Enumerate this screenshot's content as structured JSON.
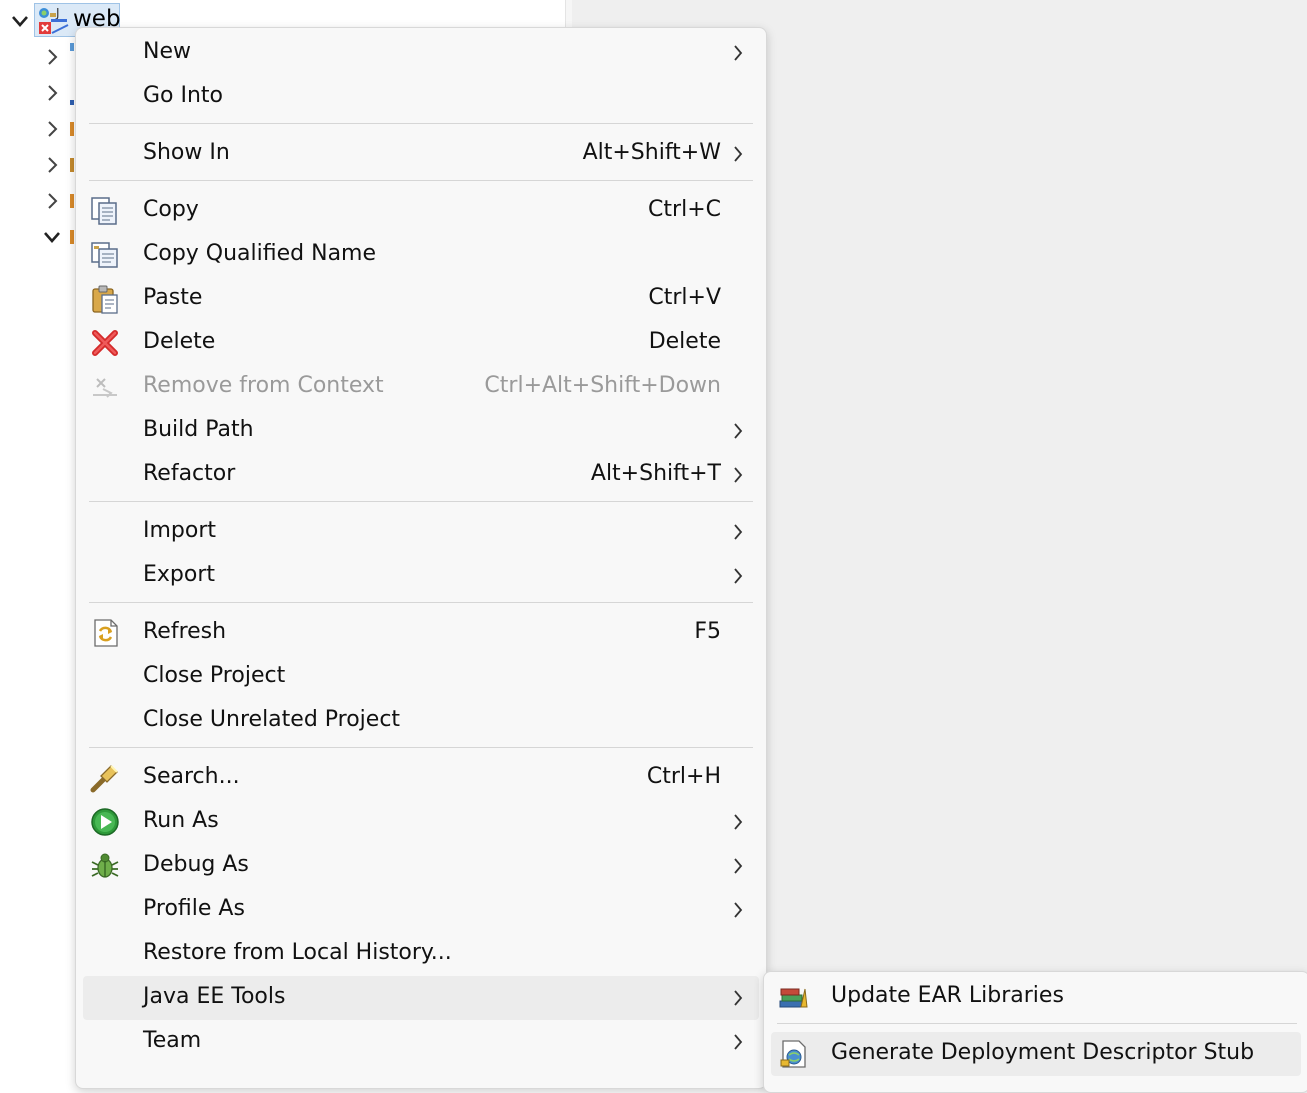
{
  "tree": {
    "project_label": "web"
  },
  "context_menu": {
    "items": [
      {
        "label": "New",
        "shortcut": "",
        "submenu": true,
        "icon": ""
      },
      {
        "label": "Go Into",
        "shortcut": "",
        "submenu": false,
        "icon": ""
      },
      {
        "label": "Show In",
        "shortcut": "Alt+Shift+W",
        "submenu": true,
        "icon": ""
      },
      {
        "label": "Copy",
        "shortcut": "Ctrl+C",
        "submenu": false,
        "icon": "copy-icon"
      },
      {
        "label": "Copy Qualified Name",
        "shortcut": "",
        "submenu": false,
        "icon": "copy-qualified-name-icon"
      },
      {
        "label": "Paste",
        "shortcut": "Ctrl+V",
        "submenu": false,
        "icon": "paste-icon"
      },
      {
        "label": "Delete",
        "shortcut": "Delete",
        "submenu": false,
        "icon": "delete-icon"
      },
      {
        "label": "Remove from Context",
        "shortcut": "Ctrl+Alt+Shift+Down",
        "submenu": false,
        "icon": "remove-from-context-icon",
        "disabled": true
      },
      {
        "label": "Build Path",
        "shortcut": "",
        "submenu": true,
        "icon": ""
      },
      {
        "label": "Refactor",
        "shortcut": "Alt+Shift+T",
        "submenu": true,
        "icon": ""
      },
      {
        "label": "Import",
        "shortcut": "",
        "submenu": true,
        "icon": ""
      },
      {
        "label": "Export",
        "shortcut": "",
        "submenu": true,
        "icon": ""
      },
      {
        "label": "Refresh",
        "shortcut": "F5",
        "submenu": false,
        "icon": "refresh-icon"
      },
      {
        "label": "Close Project",
        "shortcut": "",
        "submenu": false,
        "icon": ""
      },
      {
        "label": "Close Unrelated Project",
        "shortcut": "",
        "submenu": false,
        "icon": ""
      },
      {
        "label": "Search...",
        "shortcut": "Ctrl+H",
        "submenu": false,
        "icon": "search-flashlight-icon"
      },
      {
        "label": "Run As",
        "shortcut": "",
        "submenu": true,
        "icon": "run-icon"
      },
      {
        "label": "Debug As",
        "shortcut": "",
        "submenu": true,
        "icon": "debug-bug-icon"
      },
      {
        "label": "Profile As",
        "shortcut": "",
        "submenu": true,
        "icon": ""
      },
      {
        "label": "Restore from Local History...",
        "shortcut": "",
        "submenu": false,
        "icon": ""
      },
      {
        "label": "Java EE Tools",
        "shortcut": "",
        "submenu": true,
        "icon": "",
        "highlighted": true
      },
      {
        "label": "Team",
        "shortcut": "",
        "submenu": true,
        "icon": ""
      }
    ]
  },
  "submenu": {
    "items": [
      {
        "label": "Update EAR Libraries",
        "icon": "update-ear-libraries-icon"
      },
      {
        "label": "Generate Deployment Descriptor Stub",
        "icon": "generate-deployment-descriptor-icon",
        "highlighted": true
      }
    ]
  },
  "colors": {
    "menu_bg": "#f8f8f8",
    "highlight_bg": "#ececec",
    "disabled_text": "#9a9a9a",
    "selection_bg": "#dbe9f7"
  }
}
